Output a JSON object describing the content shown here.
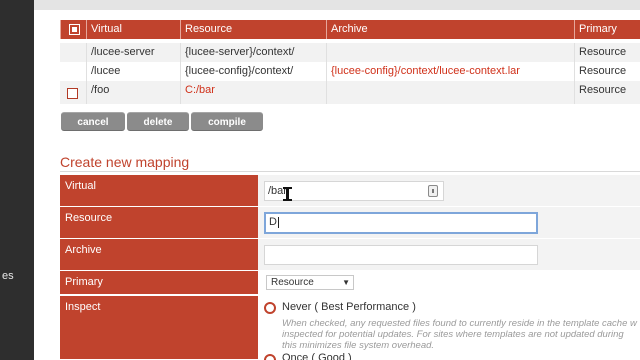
{
  "sidebar": {
    "visible_text": "es"
  },
  "table": {
    "headers": [
      "Virtual",
      "Resource",
      "Archive",
      "Primary"
    ],
    "rows": [
      {
        "virtual": "/lucee-server",
        "resource": "{lucee-server}/context/",
        "archive": "",
        "primary": "Resource"
      },
      {
        "virtual": "/lucee",
        "resource": "{lucee-config}/context/",
        "archive": "{lucee-config}/context/lucee-context.lar",
        "primary": "Resource"
      },
      {
        "virtual": "/foo",
        "resource": "C:/bar",
        "archive": "",
        "primary": "Resource"
      }
    ]
  },
  "buttons": {
    "cancel": "cancel",
    "delete": "delete",
    "compile": "compile"
  },
  "create": {
    "title": "Create new mapping",
    "labels": {
      "virtual": "Virtual",
      "resource": "Resource",
      "archive": "Archive",
      "primary": "Primary",
      "inspect": "Inspect"
    },
    "values": {
      "virtual": "/bar",
      "resource": "D",
      "archive": ""
    },
    "primary_selected": "Resource",
    "inspect_options": {
      "never": "Never ( Best Performance )",
      "never_hint_1": "When checked, any requested files found to currently reside in the template cache w",
      "never_hint_2": "inspected for potential updates. For sites where templates are not updated during",
      "never_hint_3": "this minimizes file system overhead.",
      "once": "Once ( Good )"
    }
  },
  "colors": {
    "accent": "#c0432d",
    "sidebar": "#2e2e2e",
    "button": "#8b8b8b"
  }
}
